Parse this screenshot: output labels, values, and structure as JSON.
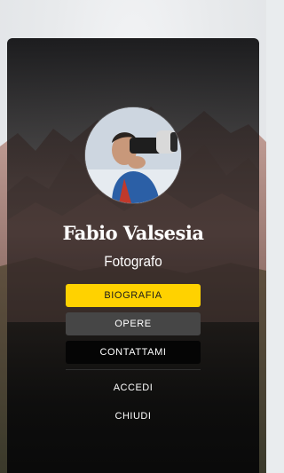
{
  "profile": {
    "name": "Fabio Valsesia",
    "role": "Fotografo"
  },
  "menu": {
    "biografia": "BIOGRAFIA",
    "opere": "OPERE",
    "contattami": "CONTATTAMI",
    "accedi": "ACCEDI",
    "chiudi": "CHIUDI"
  },
  "colors": {
    "accent": "#ffd200",
    "secondary_button": "#464646",
    "dark_button": "#050505"
  }
}
